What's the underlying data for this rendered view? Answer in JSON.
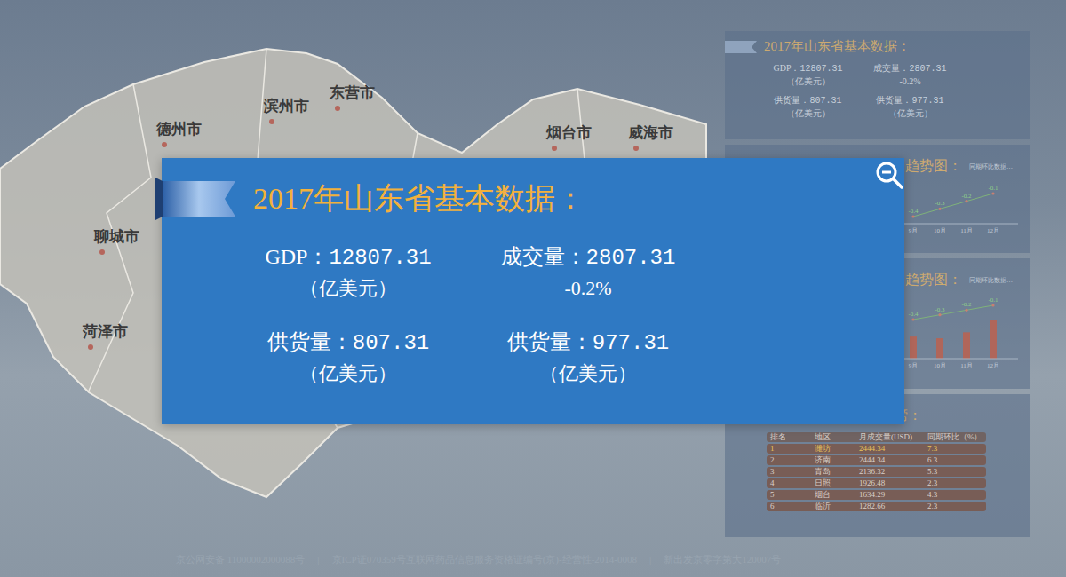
{
  "map": {
    "cities": [
      "德州市",
      "滨州市",
      "东营市",
      "烟台市",
      "威海市",
      "聊城市",
      "菏泽市"
    ]
  },
  "side_basic": {
    "title": "2017年山东省基本数据：",
    "stats": [
      {
        "label": "GDP：",
        "value": "12807.31",
        "sub": "（亿美元）"
      },
      {
        "label": "成交量：",
        "value": "2807.31",
        "sub": "-0.2%"
      },
      {
        "label": "供货量：",
        "value": "807.31",
        "sub": "（亿美元）"
      },
      {
        "label": "供货量：",
        "value": "977.31",
        "sub": "（亿美元）"
      }
    ]
  },
  "trend_line": {
    "title": "趋势图：",
    "legend": "同期环比数据…",
    "months": [
      "9月",
      "10月",
      "11月",
      "12月"
    ],
    "values": [
      -0.4,
      -0.3,
      -0.2,
      -0.1
    ],
    "labels": [
      "-0.4",
      "-0.3",
      "-0.2",
      "-0.1"
    ]
  },
  "trend_bar": {
    "title": "趋势图：",
    "legend": "同期环比数据…",
    "months": [
      "9月",
      "10月",
      "11月",
      "12月"
    ],
    "bars": [
      26,
      24,
      31,
      46
    ],
    "line": [
      -0.4,
      -0.3,
      -0.2,
      -0.1
    ],
    "labels": [
      "-0.4",
      "-0.3",
      "-0.2",
      "-0.1"
    ]
  },
  "ranking": {
    "title": "2017年山东省农产品排行榜：",
    "columns": [
      "排名",
      "地区",
      "月成交量(USD)",
      "同期环比（%）"
    ],
    "rows": [
      {
        "cells": [
          "1",
          "潍坊",
          "2444.34",
          "7.3"
        ],
        "selected": true
      },
      {
        "cells": [
          "2",
          "济南",
          "2444.34",
          "6.3"
        ],
        "selected": false
      },
      {
        "cells": [
          "3",
          "青岛",
          "2136.32",
          "5.3"
        ],
        "selected": false
      },
      {
        "cells": [
          "4",
          "日照",
          "1926.48",
          "2.3"
        ],
        "selected": false
      },
      {
        "cells": [
          "5",
          "烟台",
          "1634.29",
          "4.3"
        ],
        "selected": false
      },
      {
        "cells": [
          "6",
          "临沂",
          "1282.66",
          "2.3"
        ],
        "selected": false
      }
    ]
  },
  "footer": {
    "separator": "|",
    "items": [
      "京公网安备 11000002000088号",
      "京ICP证070359号互联网药品信息服务资格证编号(京)-经营性-2014-0008",
      "新出发京零字第大120007号"
    ]
  },
  "modal": {
    "title": "2017年山东省基本数据：",
    "stats": [
      {
        "label": "GDP：",
        "value": "12807.31",
        "sub": "（亿美元）"
      },
      {
        "label": "成交量：",
        "value": "2807.31",
        "sub": "-0.2%"
      },
      {
        "label": "供货量：",
        "value": "807.31",
        "sub": "（亿美元）"
      },
      {
        "label": "供货量：",
        "value": "977.31",
        "sub": "（亿美元）"
      }
    ]
  }
}
